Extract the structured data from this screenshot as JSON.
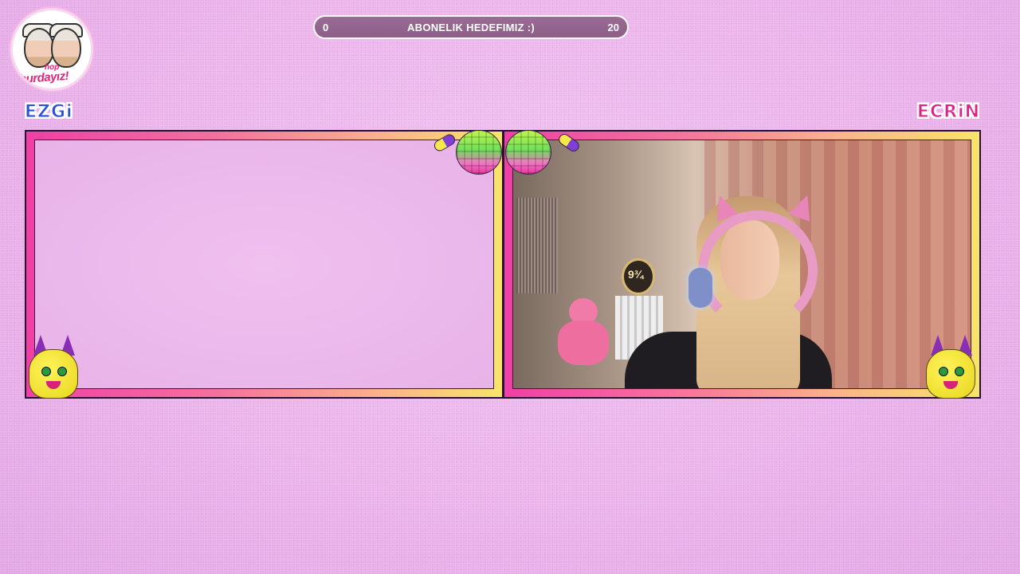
{
  "logo": {
    "line1": "hop",
    "line2": "burdayız!"
  },
  "goal": {
    "min": "0",
    "title": "ABONELIK HEDEFIMIZ :)",
    "max": "20"
  },
  "names": {
    "left": "EZGi",
    "right": "ECRiN"
  },
  "colors": {
    "background": "#eab2ea",
    "frame_pink": "#f03fa6",
    "frame_yellow": "#f8e46a",
    "left_name": "#2b4fd8",
    "right_name": "#e0218a"
  },
  "icons": [
    "disco-ball-icon",
    "pill-icon",
    "yellow-cat-mascot-icon"
  ]
}
